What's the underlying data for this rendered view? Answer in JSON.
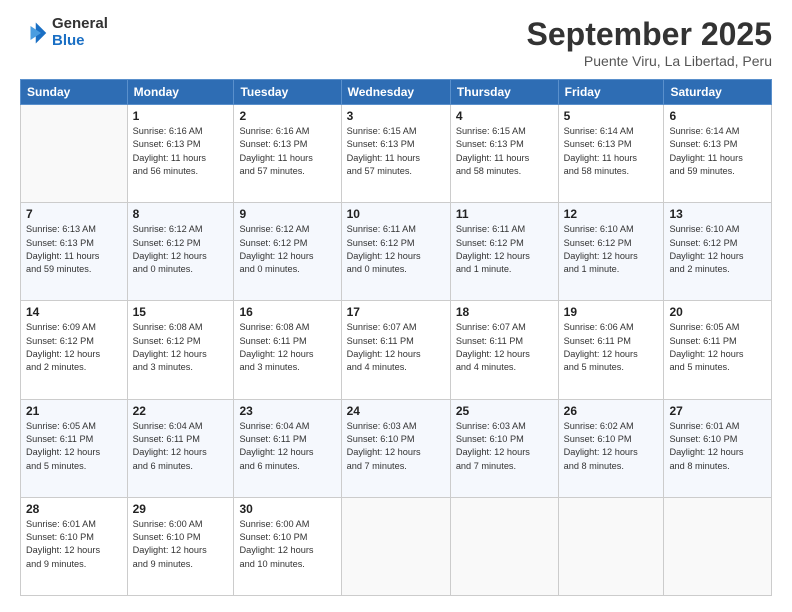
{
  "logo": {
    "general": "General",
    "blue": "Blue"
  },
  "title": "September 2025",
  "location": "Puente Viru, La Libertad, Peru",
  "days_header": [
    "Sunday",
    "Monday",
    "Tuesday",
    "Wednesday",
    "Thursday",
    "Friday",
    "Saturday"
  ],
  "weeks": [
    [
      {
        "day": "",
        "info": ""
      },
      {
        "day": "1",
        "info": "Sunrise: 6:16 AM\nSunset: 6:13 PM\nDaylight: 11 hours\nand 56 minutes."
      },
      {
        "day": "2",
        "info": "Sunrise: 6:16 AM\nSunset: 6:13 PM\nDaylight: 11 hours\nand 57 minutes."
      },
      {
        "day": "3",
        "info": "Sunrise: 6:15 AM\nSunset: 6:13 PM\nDaylight: 11 hours\nand 57 minutes."
      },
      {
        "day": "4",
        "info": "Sunrise: 6:15 AM\nSunset: 6:13 PM\nDaylight: 11 hours\nand 58 minutes."
      },
      {
        "day": "5",
        "info": "Sunrise: 6:14 AM\nSunset: 6:13 PM\nDaylight: 11 hours\nand 58 minutes."
      },
      {
        "day": "6",
        "info": "Sunrise: 6:14 AM\nSunset: 6:13 PM\nDaylight: 11 hours\nand 59 minutes."
      }
    ],
    [
      {
        "day": "7",
        "info": "Sunrise: 6:13 AM\nSunset: 6:13 PM\nDaylight: 11 hours\nand 59 minutes."
      },
      {
        "day": "8",
        "info": "Sunrise: 6:12 AM\nSunset: 6:12 PM\nDaylight: 12 hours\nand 0 minutes."
      },
      {
        "day": "9",
        "info": "Sunrise: 6:12 AM\nSunset: 6:12 PM\nDaylight: 12 hours\nand 0 minutes."
      },
      {
        "day": "10",
        "info": "Sunrise: 6:11 AM\nSunset: 6:12 PM\nDaylight: 12 hours\nand 0 minutes."
      },
      {
        "day": "11",
        "info": "Sunrise: 6:11 AM\nSunset: 6:12 PM\nDaylight: 12 hours\nand 1 minute."
      },
      {
        "day": "12",
        "info": "Sunrise: 6:10 AM\nSunset: 6:12 PM\nDaylight: 12 hours\nand 1 minute."
      },
      {
        "day": "13",
        "info": "Sunrise: 6:10 AM\nSunset: 6:12 PM\nDaylight: 12 hours\nand 2 minutes."
      }
    ],
    [
      {
        "day": "14",
        "info": "Sunrise: 6:09 AM\nSunset: 6:12 PM\nDaylight: 12 hours\nand 2 minutes."
      },
      {
        "day": "15",
        "info": "Sunrise: 6:08 AM\nSunset: 6:12 PM\nDaylight: 12 hours\nand 3 minutes."
      },
      {
        "day": "16",
        "info": "Sunrise: 6:08 AM\nSunset: 6:11 PM\nDaylight: 12 hours\nand 3 minutes."
      },
      {
        "day": "17",
        "info": "Sunrise: 6:07 AM\nSunset: 6:11 PM\nDaylight: 12 hours\nand 4 minutes."
      },
      {
        "day": "18",
        "info": "Sunrise: 6:07 AM\nSunset: 6:11 PM\nDaylight: 12 hours\nand 4 minutes."
      },
      {
        "day": "19",
        "info": "Sunrise: 6:06 AM\nSunset: 6:11 PM\nDaylight: 12 hours\nand 5 minutes."
      },
      {
        "day": "20",
        "info": "Sunrise: 6:05 AM\nSunset: 6:11 PM\nDaylight: 12 hours\nand 5 minutes."
      }
    ],
    [
      {
        "day": "21",
        "info": "Sunrise: 6:05 AM\nSunset: 6:11 PM\nDaylight: 12 hours\nand 5 minutes."
      },
      {
        "day": "22",
        "info": "Sunrise: 6:04 AM\nSunset: 6:11 PM\nDaylight: 12 hours\nand 6 minutes."
      },
      {
        "day": "23",
        "info": "Sunrise: 6:04 AM\nSunset: 6:11 PM\nDaylight: 12 hours\nand 6 minutes."
      },
      {
        "day": "24",
        "info": "Sunrise: 6:03 AM\nSunset: 6:10 PM\nDaylight: 12 hours\nand 7 minutes."
      },
      {
        "day": "25",
        "info": "Sunrise: 6:03 AM\nSunset: 6:10 PM\nDaylight: 12 hours\nand 7 minutes."
      },
      {
        "day": "26",
        "info": "Sunrise: 6:02 AM\nSunset: 6:10 PM\nDaylight: 12 hours\nand 8 minutes."
      },
      {
        "day": "27",
        "info": "Sunrise: 6:01 AM\nSunset: 6:10 PM\nDaylight: 12 hours\nand 8 minutes."
      }
    ],
    [
      {
        "day": "28",
        "info": "Sunrise: 6:01 AM\nSunset: 6:10 PM\nDaylight: 12 hours\nand 9 minutes."
      },
      {
        "day": "29",
        "info": "Sunrise: 6:00 AM\nSunset: 6:10 PM\nDaylight: 12 hours\nand 9 minutes."
      },
      {
        "day": "30",
        "info": "Sunrise: 6:00 AM\nSunset: 6:10 PM\nDaylight: 12 hours\nand 10 minutes."
      },
      {
        "day": "",
        "info": ""
      },
      {
        "day": "",
        "info": ""
      },
      {
        "day": "",
        "info": ""
      },
      {
        "day": "",
        "info": ""
      }
    ]
  ]
}
